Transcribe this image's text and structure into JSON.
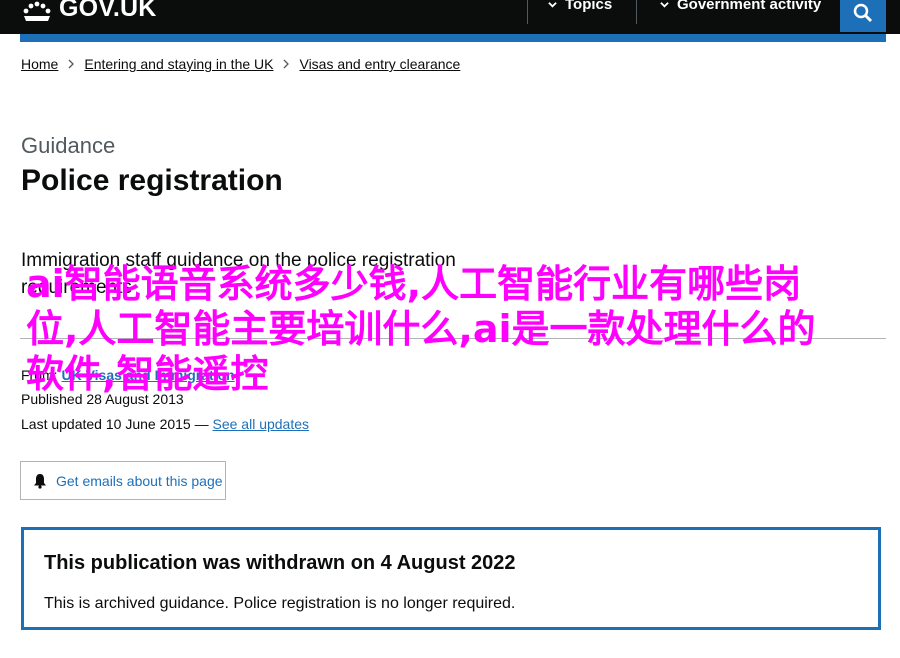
{
  "header": {
    "logo_text": "GOV.UK",
    "nav": [
      {
        "label": "Topics"
      },
      {
        "label": "Government activity"
      }
    ],
    "search_icon": "search-icon",
    "colors": {
      "header_bg": "#0b0c0c",
      "accent": "#1d70b8"
    }
  },
  "breadcrumbs": [
    {
      "label": "Home"
    },
    {
      "label": "Entering and staying in the UK"
    },
    {
      "label": "Visas and entry clearance"
    }
  ],
  "page": {
    "caption": "Guidance",
    "title": "Police registration",
    "summary": "Immigration staff guidance on the police registration requirements"
  },
  "metadata": {
    "from_label": "From:",
    "from_value": "UK Visas and Immigration",
    "published_label": "Published",
    "published_value": "28 August 2013",
    "updated_label": "Last updated",
    "updated_value": "10 June 2015",
    "updated_sep": " — ",
    "see_updates": "See all updates"
  },
  "email_button": {
    "label": "Get emails about this page",
    "icon": "bell-icon"
  },
  "notice": {
    "title": "This publication was withdrawn on 4 August 2022",
    "text": "This is archived guidance. Police registration is no longer required."
  },
  "overlay_text": "ai智能语音系统多少钱,人工智能行业有哪些岗位,人工智能主要培训什么,ai是一款处理什么的软件,智能遥控"
}
